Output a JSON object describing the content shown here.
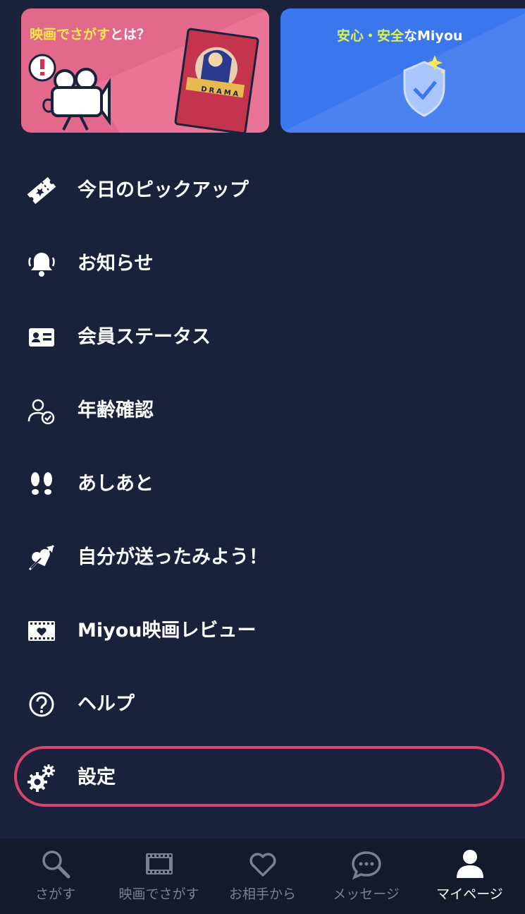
{
  "banners": {
    "movie": {
      "title_highlight": "映画でさがす",
      "title_rest": "とは？",
      "card_text": "DRAMA"
    },
    "safety": {
      "title_part1": "安心・安全",
      "title_part2": "なMiyou"
    }
  },
  "menu": {
    "items": [
      {
        "label": "今日のピックアップ",
        "icon": "ticket-icon"
      },
      {
        "label": "お知らせ",
        "icon": "bell-icon"
      },
      {
        "label": "会員ステータス",
        "icon": "member-card-icon"
      },
      {
        "label": "年齢確認",
        "icon": "user-check-icon"
      },
      {
        "label": "あしあと",
        "icon": "footprints-icon"
      },
      {
        "label": "自分が送ったみよう！",
        "icon": "heart-arrow-icon"
      },
      {
        "label": "Miyou映画レビュー",
        "icon": "film-heart-icon"
      },
      {
        "label": "ヘルプ",
        "icon": "help-icon"
      },
      {
        "label": "設定",
        "icon": "gear-icon"
      }
    ],
    "highlight_color": "#d9436f"
  },
  "tabbar": {
    "tabs": [
      {
        "label": "さがす",
        "icon": "search-icon",
        "active": false
      },
      {
        "label": "映画でさがす",
        "icon": "film-icon",
        "active": false
      },
      {
        "label": "お相手から",
        "icon": "heart-icon",
        "active": false
      },
      {
        "label": "メッセージ",
        "icon": "chat-icon",
        "active": false
      },
      {
        "label": "マイページ",
        "icon": "person-icon",
        "active": true
      }
    ]
  },
  "colors": {
    "background": "#1a213b",
    "tabbar": "#141a2c",
    "inactive": "#7b8192",
    "active": "#ffffff"
  }
}
